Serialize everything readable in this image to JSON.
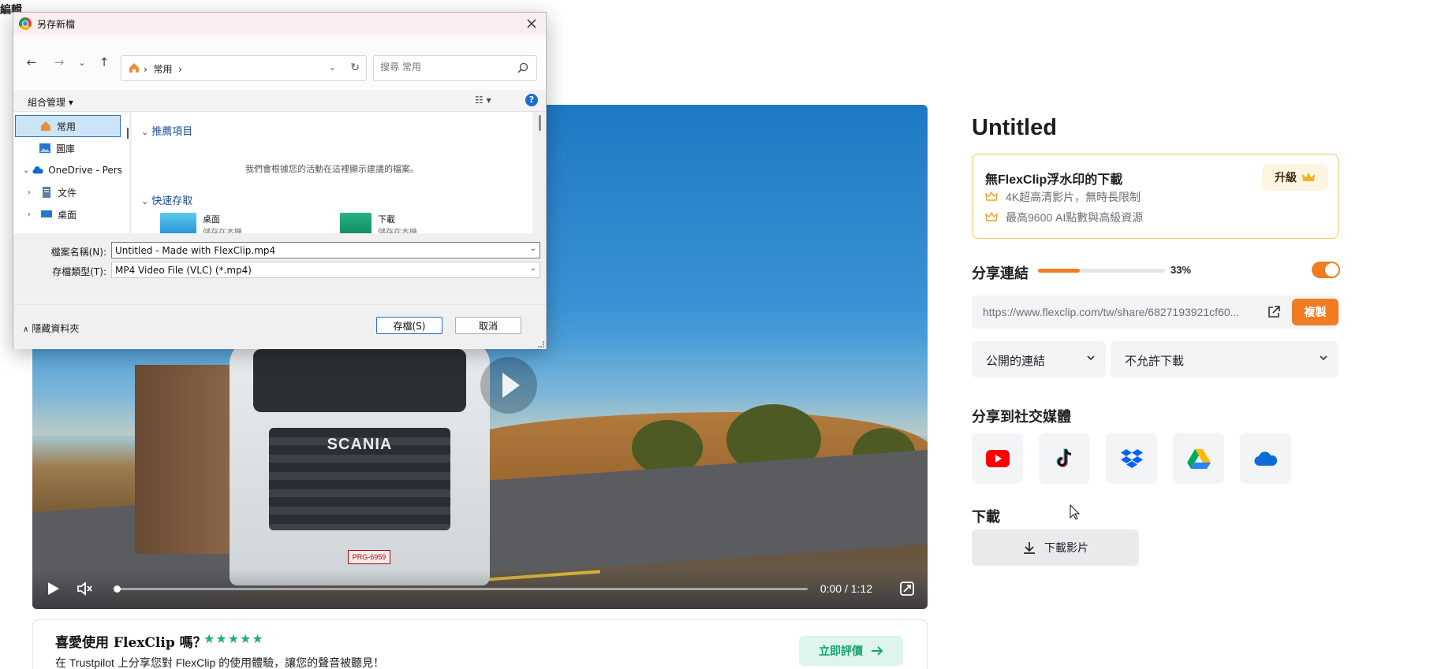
{
  "corner_text": "編輯",
  "video": {
    "timecode": "0:00 / 1:12",
    "plate_text": "PRG-6959",
    "truck_brand": "SCANIA",
    "progress": 0.0
  },
  "review": {
    "title": "喜愛使用 FlexClip 嗎？",
    "stars": "★★★★★",
    "subtitle": "在 Trustpilot 上分享您對 FlexClip 的使用體驗，讓您的聲音被聽見！",
    "button_label": "立即評價"
  },
  "panel": {
    "project_title": "Untitled",
    "upgrade": {
      "title": "無FlexClip浮水印的下載",
      "features": [
        "4K超高清影片，無時長限制",
        "最高9600 AI點數與高級資源"
      ],
      "button_label": "升級"
    },
    "share": {
      "label": "分享連結",
      "percent_text": "33%",
      "progress": 0.33,
      "toggle_on": true,
      "url": "https://www.flexclip.com/tw/share/6827193921cf60...",
      "copy_label": "複製",
      "visibility": "公開的連結",
      "download_permission": "不允許下載"
    },
    "social": {
      "label": "分享到社交媒體",
      "items": [
        "youtube-icon",
        "tiktok-icon",
        "dropbox-icon",
        "google-drive-icon",
        "onedrive-icon"
      ]
    },
    "download": {
      "label": "下載",
      "button_label": "下載影片"
    }
  },
  "dialog": {
    "title": "另存新檔",
    "breadcrumb": "常用",
    "search_placeholder": "搜尋 常用",
    "organize_label": "組合管理 ▾",
    "nav_items": [
      "常用",
      "圖庫",
      "OneDrive - Pers",
      "文件",
      "桌面"
    ],
    "groups": {
      "recommended": "推薦項目",
      "empty_message": "我們會根據您的活動在這裡顯示建議的檔案。",
      "quick_access": "快速存取"
    },
    "tiles": [
      {
        "name": "桌面",
        "sub": "儲存在本機"
      },
      {
        "name": "下載",
        "sub": "儲存在本機"
      }
    ],
    "filename_label": "檔案名稱(N):",
    "filename_value": "Untitled - Made with FlexClip.mp4",
    "filetype_label": "存檔類型(T):",
    "filetype_value": "MP4 Video File (VLC) (*.mp4)",
    "hide_folders_label": "隱藏資料夾",
    "save_label": "存檔(S)",
    "cancel_label": "取消"
  },
  "colors": {
    "accent_orange": "#f07b21",
    "upgrade_border": "#f6c65b",
    "trustpilot_green": "#1fb07a"
  }
}
